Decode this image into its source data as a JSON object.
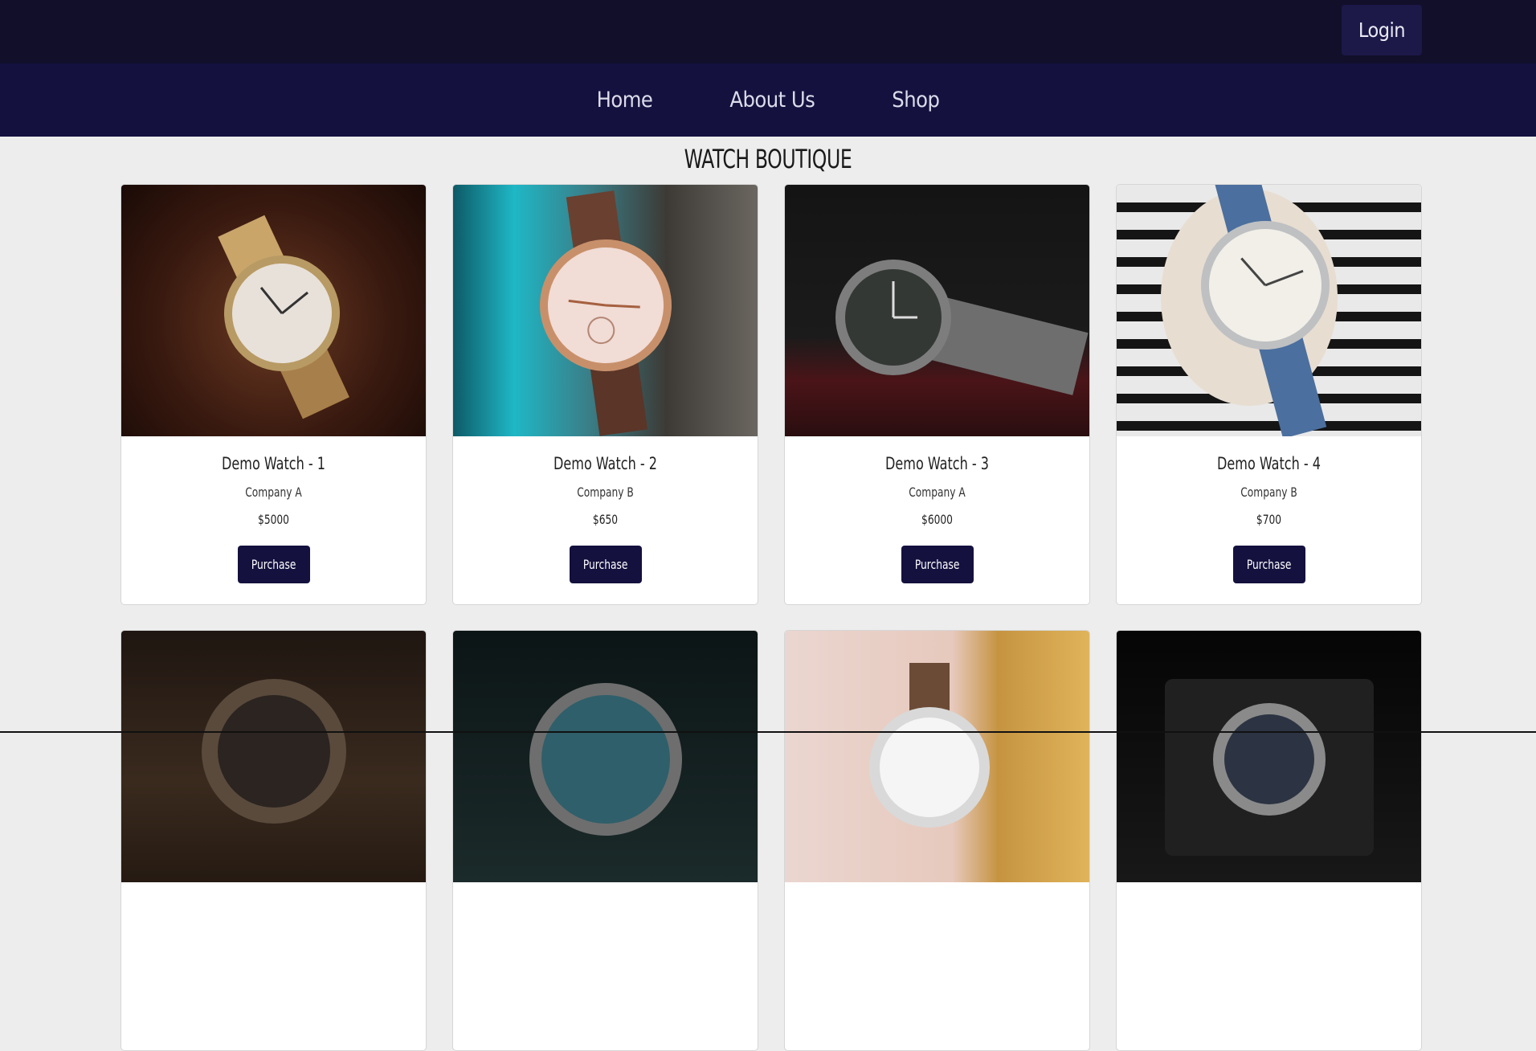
{
  "header": {
    "login_label": "Login"
  },
  "nav": {
    "items": [
      {
        "label": "Home"
      },
      {
        "label": "About Us"
      },
      {
        "label": "Shop"
      }
    ]
  },
  "page": {
    "title": "WATCH BOUTIQUE"
  },
  "products": [
    {
      "name": "Demo Watch - 1",
      "company": "Company A",
      "price": "$5000",
      "button": "Purchase"
    },
    {
      "name": "Demo Watch - 2",
      "company": "Company B",
      "price": "$650",
      "button": "Purchase"
    },
    {
      "name": "Demo Watch - 3",
      "company": "Company A",
      "price": "$6000",
      "button": "Purchase"
    },
    {
      "name": "Demo Watch - 4",
      "company": "Company B",
      "price": "$700",
      "button": "Purchase"
    }
  ],
  "colors": {
    "topbar": "#110f2a",
    "navbar": "#14113f",
    "accent_button": "#14113f",
    "page_background": "#ededed"
  }
}
